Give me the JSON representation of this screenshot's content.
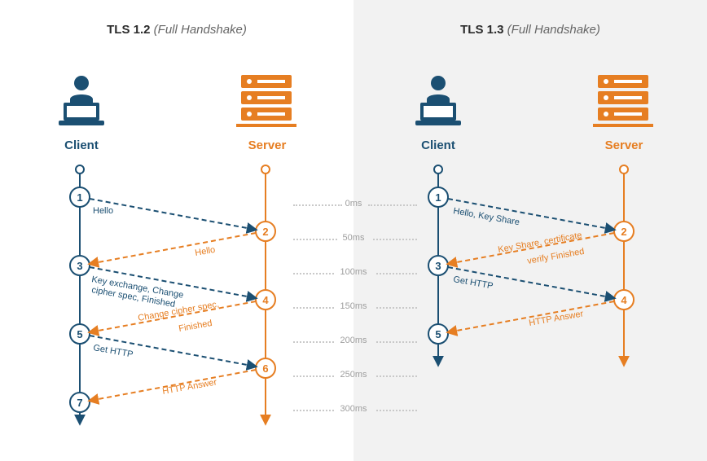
{
  "tls12": {
    "title_bold": "TLS 1.2",
    "title_italic": "(Full Handshake)",
    "client_label": "Client",
    "server_label": "Server",
    "steps": [
      "1",
      "2",
      "3",
      "4",
      "5",
      "6",
      "7"
    ],
    "messages": {
      "m1": "Hello",
      "m2": "Hello",
      "m3a": "Key exchange, Change",
      "m3b": "cipher spec, Finished",
      "m4a": "Change cipher spec,",
      "m4b": "Finished",
      "m5": "Get HTTP",
      "m6": "HTTP Answer"
    }
  },
  "tls13": {
    "title_bold": "TLS 1.3",
    "title_italic": "(Full Handshake)",
    "client_label": "Client",
    "server_label": "Server",
    "steps": [
      "1",
      "2",
      "3",
      "4",
      "5"
    ],
    "messages": {
      "m1": "Hello, Key Share",
      "m2a": "Key Share, certificate",
      "m2b": "verify  Finished",
      "m3": "Get HTTP",
      "m4": "HTTP Answer"
    }
  },
  "timescale": {
    "t0": "0ms",
    "t50": "50ms",
    "t100": "100ms",
    "t150": "150ms",
    "t200": "200ms",
    "t250": "250ms",
    "t300": "300ms"
  },
  "chart_data": {
    "type": "diagram",
    "description": "TLS handshake sequence diagrams comparing TLS 1.2 vs TLS 1.3 full handshake round trips",
    "time_axis_ms": [
      0,
      50,
      100,
      150,
      200,
      250,
      300
    ],
    "tls12_sequence": [
      {
        "step": 1,
        "from": "client",
        "to": "server",
        "label": "Hello",
        "approx_time_ms": 0
      },
      {
        "step": 2,
        "from": "server",
        "to": "client",
        "label": "Hello",
        "approx_time_ms": 50
      },
      {
        "step": 3,
        "from": "client",
        "to": "server",
        "label": "Key exchange, Change cipher spec, Finished",
        "approx_time_ms": 100
      },
      {
        "step": 4,
        "from": "server",
        "to": "client",
        "label": "Change cipher spec, Finished",
        "approx_time_ms": 150
      },
      {
        "step": 5,
        "from": "client",
        "to": "server",
        "label": "Get HTTP",
        "approx_time_ms": 200
      },
      {
        "step": 6,
        "from": "server",
        "to": "client",
        "label": "HTTP Answer",
        "approx_time_ms": 250
      },
      {
        "step": 7,
        "from": "client",
        "to": null,
        "label": "",
        "approx_time_ms": 300
      }
    ],
    "tls13_sequence": [
      {
        "step": 1,
        "from": "client",
        "to": "server",
        "label": "Hello, Key Share",
        "approx_time_ms": 0
      },
      {
        "step": 2,
        "from": "server",
        "to": "client",
        "label": "Key Share, certificate verify Finished",
        "approx_time_ms": 50
      },
      {
        "step": 3,
        "from": "client",
        "to": "server",
        "label": "Get HTTP",
        "approx_time_ms": 100
      },
      {
        "step": 4,
        "from": "server",
        "to": "client",
        "label": "HTTP Answer",
        "approx_time_ms": 150
      },
      {
        "step": 5,
        "from": "client",
        "to": null,
        "label": "",
        "approx_time_ms": 200
      }
    ]
  }
}
